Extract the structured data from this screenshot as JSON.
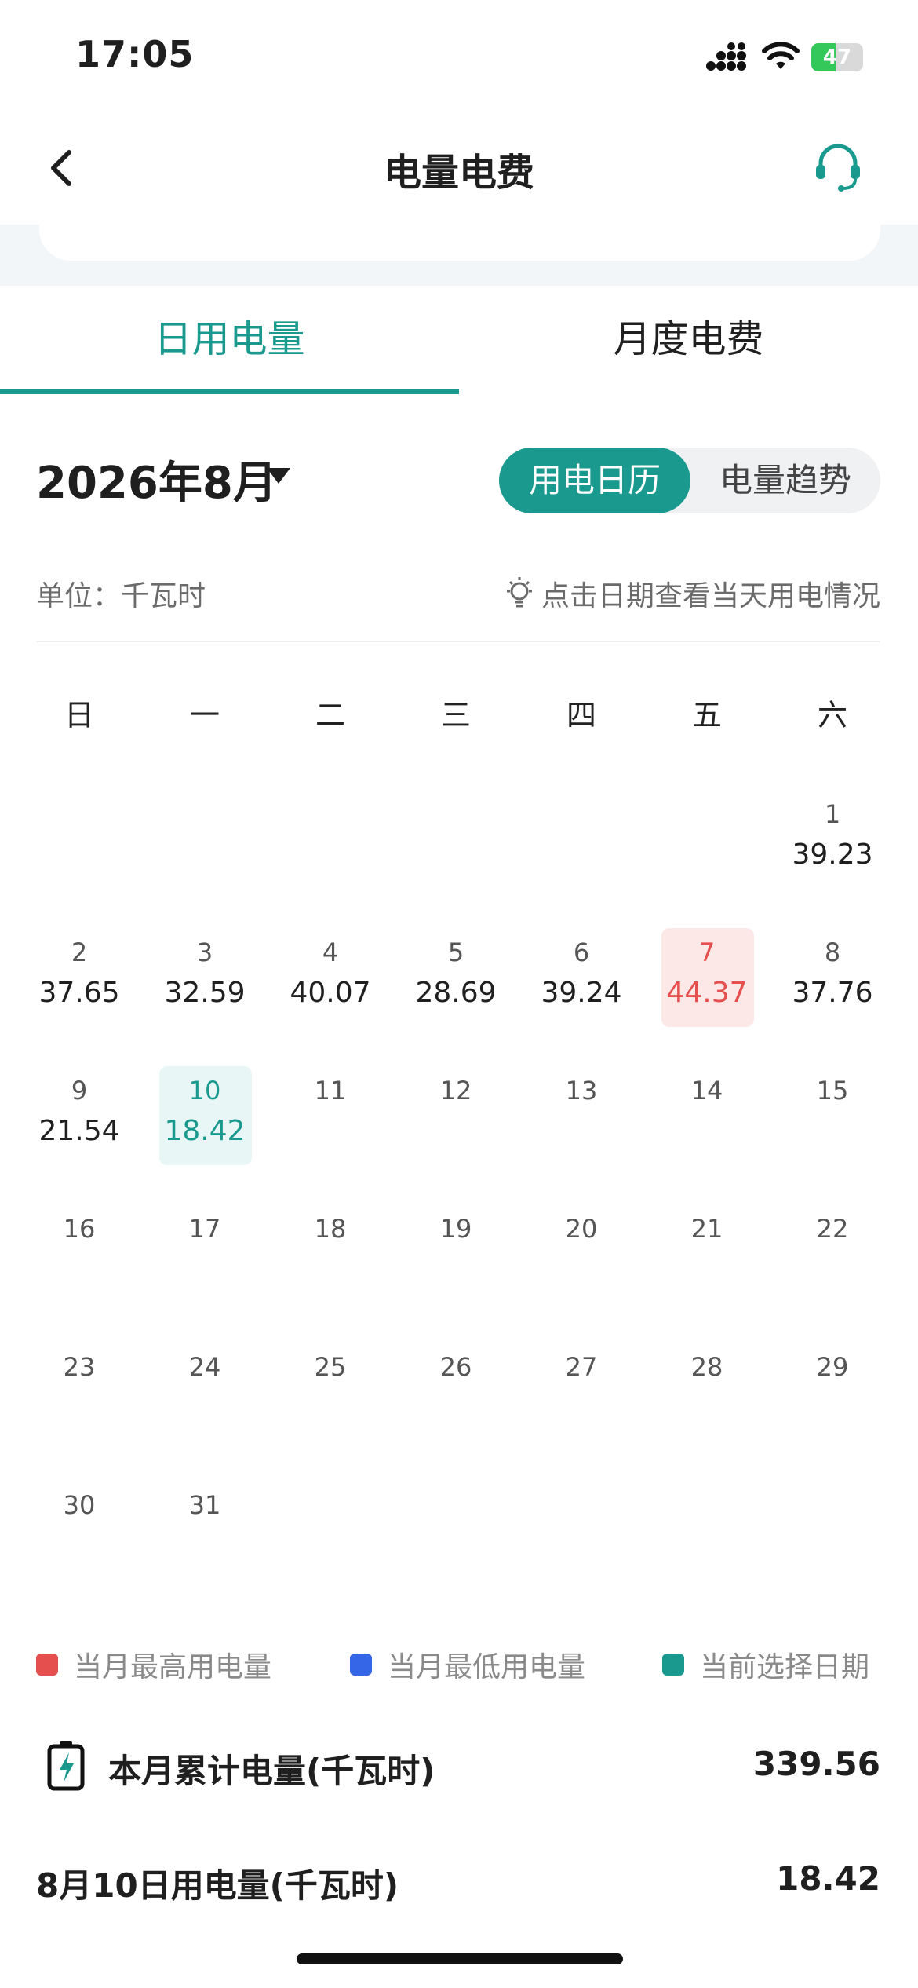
{
  "status_bar": {
    "time": "17:05",
    "battery": "47"
  },
  "header": {
    "title": "电量电费"
  },
  "tabs": [
    {
      "label": "日用电量",
      "active": true
    },
    {
      "label": "月度电费",
      "active": false
    }
  ],
  "month_selector": {
    "label": "2026年8月"
  },
  "view_toggle": {
    "active": "用电日历",
    "inactive": "电量趋势"
  },
  "unit_label": "单位：千瓦时",
  "hint": "点击日期查看当天用电情况",
  "weekdays": [
    "日",
    "一",
    "二",
    "三",
    "四",
    "五",
    "六"
  ],
  "calendar": {
    "first_weekday_index": 6,
    "days": [
      {
        "d": "1",
        "v": "39.23"
      },
      {
        "d": "2",
        "v": "37.65"
      },
      {
        "d": "3",
        "v": "32.59"
      },
      {
        "d": "4",
        "v": "40.07"
      },
      {
        "d": "5",
        "v": "28.69"
      },
      {
        "d": "6",
        "v": "39.24"
      },
      {
        "d": "7",
        "v": "44.37",
        "state": "max"
      },
      {
        "d": "8",
        "v": "37.76"
      },
      {
        "d": "9",
        "v": "21.54"
      },
      {
        "d": "10",
        "v": "18.42",
        "state": "selected"
      },
      {
        "d": "11",
        "v": ""
      },
      {
        "d": "12",
        "v": ""
      },
      {
        "d": "13",
        "v": ""
      },
      {
        "d": "14",
        "v": ""
      },
      {
        "d": "15",
        "v": ""
      },
      {
        "d": "16",
        "v": ""
      },
      {
        "d": "17",
        "v": ""
      },
      {
        "d": "18",
        "v": ""
      },
      {
        "d": "19",
        "v": ""
      },
      {
        "d": "20",
        "v": ""
      },
      {
        "d": "21",
        "v": ""
      },
      {
        "d": "22",
        "v": ""
      },
      {
        "d": "23",
        "v": ""
      },
      {
        "d": "24",
        "v": ""
      },
      {
        "d": "25",
        "v": ""
      },
      {
        "d": "26",
        "v": ""
      },
      {
        "d": "27",
        "v": ""
      },
      {
        "d": "28",
        "v": ""
      },
      {
        "d": "29",
        "v": ""
      },
      {
        "d": "30",
        "v": ""
      },
      {
        "d": "31",
        "v": ""
      }
    ]
  },
  "legend": [
    {
      "label": "当月最高用电量",
      "color": "#e5504f"
    },
    {
      "label": "当月最低用电量",
      "color": "#3566e8"
    },
    {
      "label": "当前选择日期",
      "color": "#1a9a8f"
    }
  ],
  "summary": {
    "label": "本月累计电量(千瓦时)",
    "value": "339.56",
    "icon": "battery-charge-icon"
  },
  "selected_day": {
    "label": "8月10日用电量(千瓦时)",
    "value": "18.42"
  },
  "colors": {
    "accent": "#1a9a8f",
    "max": "#e5504f",
    "min": "#3566e8"
  }
}
